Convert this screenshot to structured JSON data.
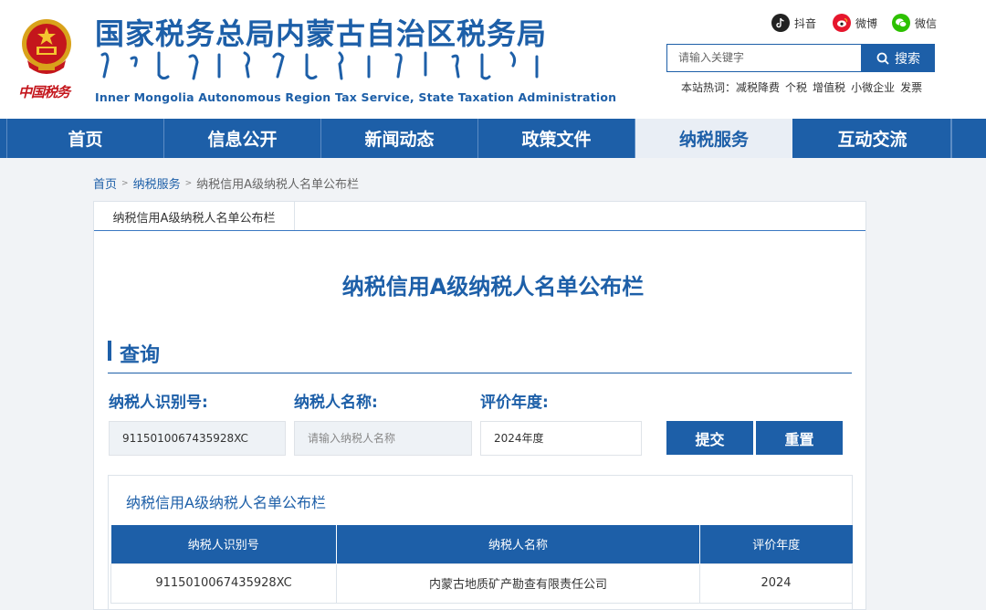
{
  "header": {
    "emblem_text": "中国税务",
    "title": "国家税务总局内蒙古自治区税务局",
    "subtitle": "Inner Mongolia Autonomous Region Tax Service, State Taxation Administration"
  },
  "social": {
    "douyin": "抖音",
    "weibo": "微博",
    "wechat": "微信"
  },
  "search": {
    "placeholder": "请输入关键字",
    "button": "搜索"
  },
  "hot": {
    "label": "本站热词：",
    "terms": [
      "减税降费",
      "个税",
      "增值税",
      "小微企业",
      "发票"
    ]
  },
  "nav": {
    "items": [
      "首页",
      "信息公开",
      "新闻动态",
      "政策文件",
      "纳税服务",
      "互动交流"
    ],
    "active_index": 4
  },
  "breadcrumb": {
    "home": "首页",
    "section": "纳税服务",
    "current": "纳税信用A级纳税人名单公布栏",
    "separator": ">"
  },
  "panel": {
    "tab": "纳税信用A级纳税人名单公布栏",
    "title": "纳税信用A级纳税人名单公布栏"
  },
  "query": {
    "section_title": "查询",
    "taxpayer_id_label": "纳税人识别号:",
    "taxpayer_id_value": "9115010067435928XC",
    "taxpayer_name_label": "纳税人名称:",
    "taxpayer_name_placeholder": "请输入纳税人名称",
    "year_label": "评价年度:",
    "year_value": "2024年度",
    "submit": "提交",
    "reset": "重置"
  },
  "results": {
    "title": "纳税信用A级纳税人名单公布栏",
    "columns": [
      "纳税人识别号",
      "纳税人名称",
      "评价年度"
    ],
    "rows": [
      [
        "9115010067435928XC",
        "内蒙古地质矿产勘查有限责任公司",
        "2024"
      ]
    ]
  },
  "colors": {
    "brand_blue": "#1d5fa8",
    "emblem_red": "#c4161c"
  }
}
